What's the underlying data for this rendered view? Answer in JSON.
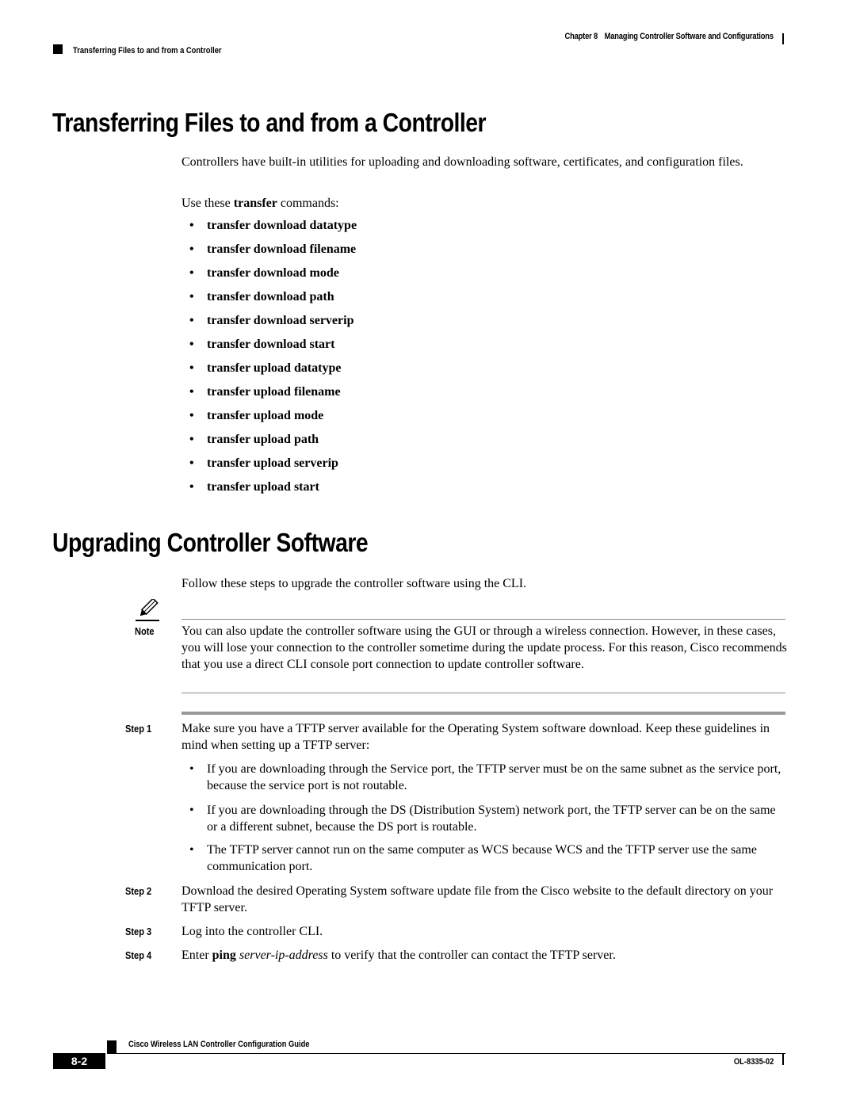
{
  "header": {
    "chapter": "Chapter 8",
    "chapter_title": "Managing Controller Software and Configurations",
    "section": "Transferring Files to and from a Controller"
  },
  "section1": {
    "title": "Transferring Files to and from a Controller",
    "intro": "Controllers have built-in utilities for uploading and downloading software, certificates, and configuration files.",
    "use_prefix": "Use these ",
    "use_bold": "transfer",
    "use_suffix": " commands:",
    "bullet": "•",
    "commands": [
      "transfer download datatype",
      "transfer download filename",
      "transfer download mode",
      "transfer download path",
      "transfer download serverip",
      "transfer download start",
      "transfer upload datatype",
      "transfer upload filename",
      "transfer upload mode",
      "transfer upload path",
      "transfer upload serverip",
      "transfer upload start"
    ]
  },
  "section2": {
    "title": "Upgrading Controller Software",
    "intro": "Follow these steps to upgrade the controller software using the CLI.",
    "note": {
      "icon": "pencil-note-icon",
      "label": "Note",
      "text": "You can also update the controller software using the GUI or through a wireless connection. However, in these cases, you will lose your connection to the controller sometime during the update process. For this reason, Cisco recommends that you use a direct CLI console port connection to update controller software."
    },
    "steps": [
      {
        "label": "Step 1",
        "text": "Make sure you have a TFTP server available for the Operating System software download. Keep these guidelines in mind when setting up a TFTP server:",
        "bullets": [
          "If you are downloading through the Service port, the TFTP server must be on the same subnet as the service port, because the service port is not routable.",
          "If you are downloading through the DS (Distribution System) network port, the TFTP server can be on the same or a different subnet, because the DS port is routable.",
          "The TFTP server cannot run on the same computer as WCS because WCS and the TFTP server use the same communication port."
        ]
      },
      {
        "label": "Step 2",
        "text": "Download the desired Operating System software update file from the Cisco website to the default directory on your TFTP server."
      },
      {
        "label": "Step 3",
        "text": "Log into the controller CLI."
      },
      {
        "label": "Step 4",
        "text_prefix": "Enter ",
        "text_bold": "ping",
        "text_space": " ",
        "text_italic": "server-ip-address",
        "text_suffix": " to verify that the controller can contact the TFTP server."
      }
    ]
  },
  "footer": {
    "guide_title": "Cisco Wireless LAN Controller Configuration Guide",
    "page_number": "8-2",
    "doc_number": "OL-8335-02"
  }
}
